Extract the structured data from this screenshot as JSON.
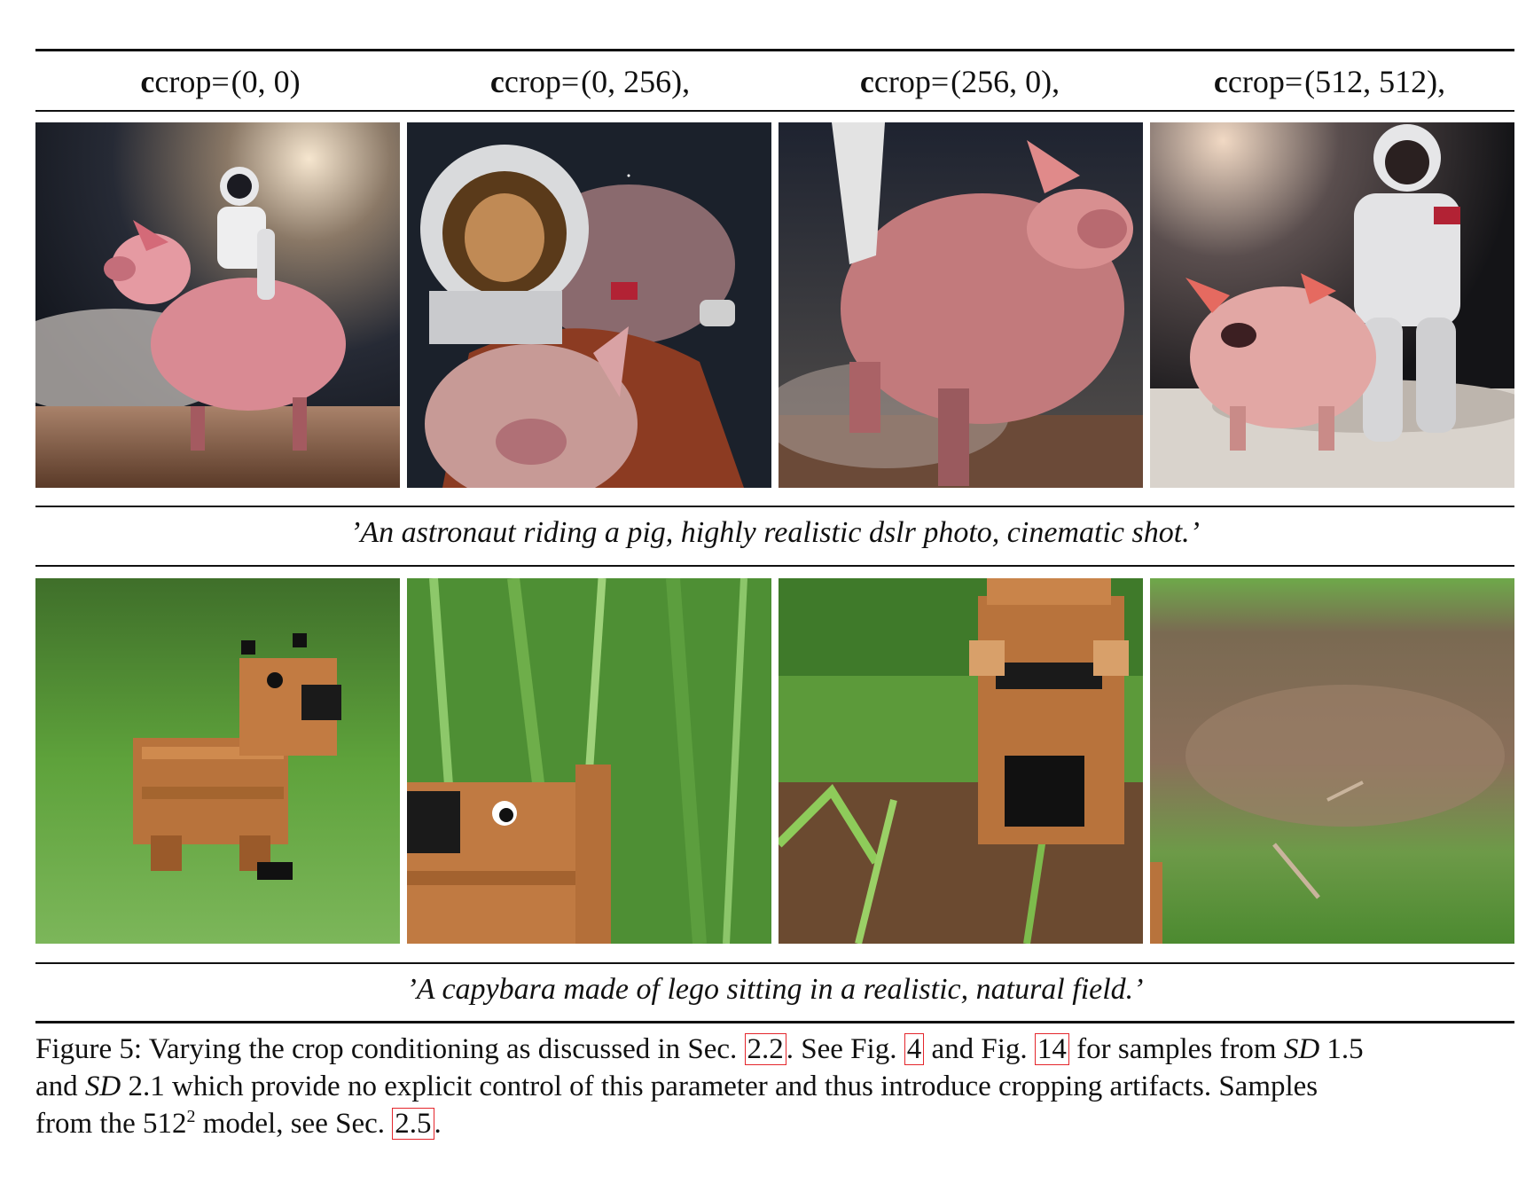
{
  "header": {
    "columns": [
      {
        "symbol": "c",
        "subscript": "crop",
        "equals": " = ",
        "value": "(0, 0)"
      },
      {
        "symbol": "c",
        "subscript": "crop",
        "equals": " = ",
        "value": "(0, 256),"
      },
      {
        "symbol": "c",
        "subscript": "crop",
        "equals": " = ",
        "value": "(256, 0),"
      },
      {
        "symbol": "c",
        "subscript": "crop",
        "equals": " = ",
        "value": "(512, 512),"
      }
    ]
  },
  "rows": [
    {
      "prompt": "’An astronaut riding a pig, highly realistic dslr photo, cinematic shot.’",
      "images": [
        {
          "description": "astronaut riding pig, full view",
          "icon": "pig-astronaut-photo"
        },
        {
          "description": "astronaut helmet close-up with pig below",
          "icon": "pig-astronaut-photo"
        },
        {
          "description": "running pig close-up",
          "icon": "pig-astronaut-photo"
        },
        {
          "description": "astronaut walking next to pig",
          "icon": "pig-astronaut-photo"
        }
      ]
    },
    {
      "prompt": "’A capybara made of lego sitting in a realistic, natural field.’",
      "images": [
        {
          "description": "lego capybara in grass",
          "icon": "lego-capybara-photo"
        },
        {
          "description": "lego capybara partially cropped",
          "icon": "lego-capybara-photo"
        },
        {
          "description": "lego capybara body cropped",
          "icon": "lego-capybara-photo"
        },
        {
          "description": "grass and soil, capybara cropped out",
          "icon": "lego-capybara-photo"
        }
      ]
    }
  ],
  "caption": {
    "line1_a": "Figure 5: Varying the crop conditioning as discussed in Sec. ",
    "ref_sec_a": "2.2",
    "line1_b": ". See Fig. ",
    "ref_fig_a": "4",
    "line1_c": " and Fig. ",
    "ref_fig_b": "14",
    "line1_d": " for samples from ",
    "sd_a": "SD",
    "line1_e": " 1.5",
    "line2_a": "and ",
    "sd_b": "SD",
    "line2_b": " 2.1 which provide no explicit control of this parameter and thus introduce cropping artifacts. Samples",
    "line3_a": "from the 512",
    "line3_sup": "2",
    "line3_b": " model, see Sec. ",
    "ref_sec_b": "2.5",
    "line3_c": "."
  },
  "colors": {
    "link_box": "#e4262c",
    "rule": "#111111",
    "space_bg": "#1a1f2a",
    "grass": "#4f9a2f",
    "lego": "#b8733c"
  }
}
